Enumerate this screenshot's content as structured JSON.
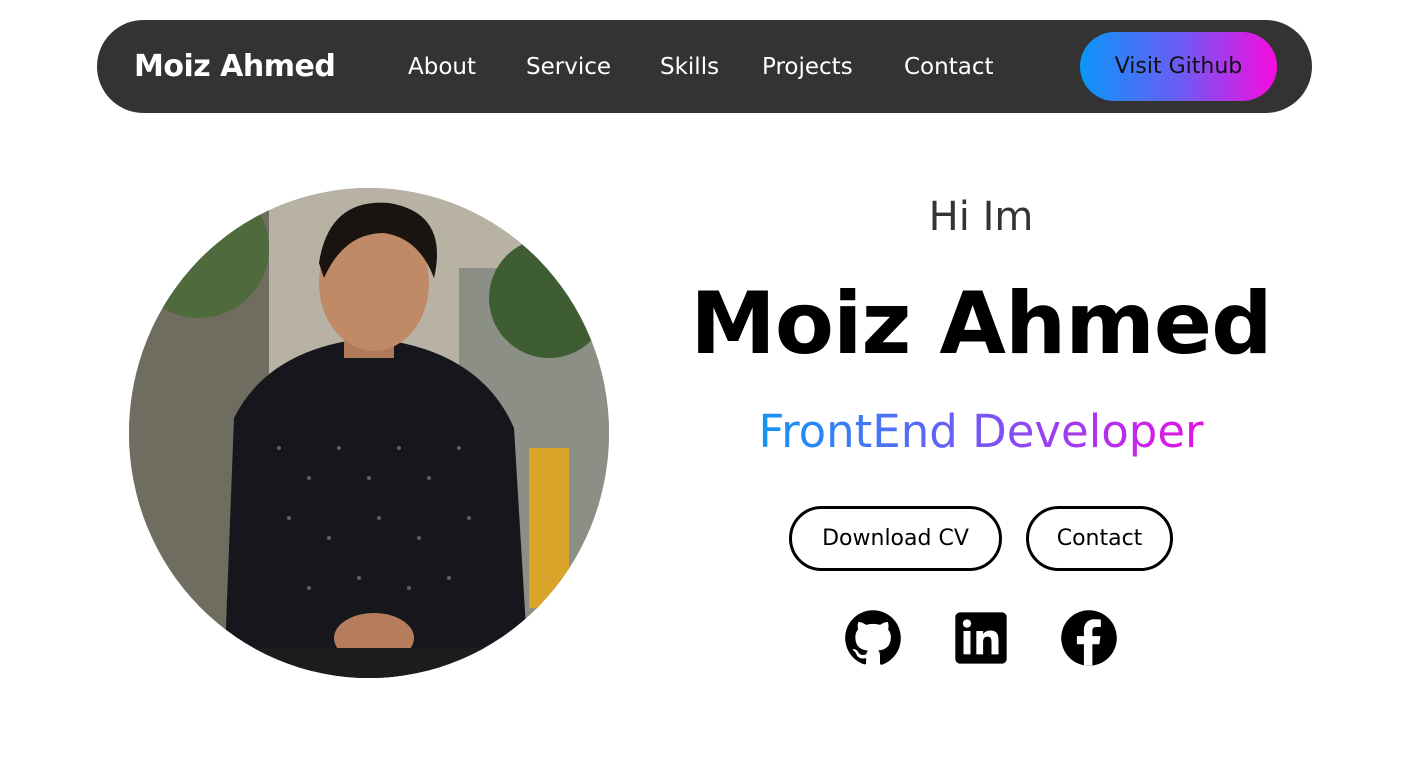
{
  "nav": {
    "brand": "Moiz Ahmed",
    "links": [
      "About",
      "Service",
      "Skills",
      "Projects",
      "Contact"
    ],
    "github_button": "Visit Github"
  },
  "hero": {
    "greeting": "Hi Im",
    "name": "Moiz Ahmed",
    "role": "FrontEnd Developer",
    "buttons": [
      "Download CV",
      "Contact"
    ]
  },
  "social": [
    "github-icon",
    "linkedin-icon",
    "facebook-icon"
  ],
  "colors": {
    "navbar_bg": "#333333",
    "gradient_start": "#0a97f8",
    "gradient_end": "#f70be0",
    "text_dark": "#000000"
  }
}
